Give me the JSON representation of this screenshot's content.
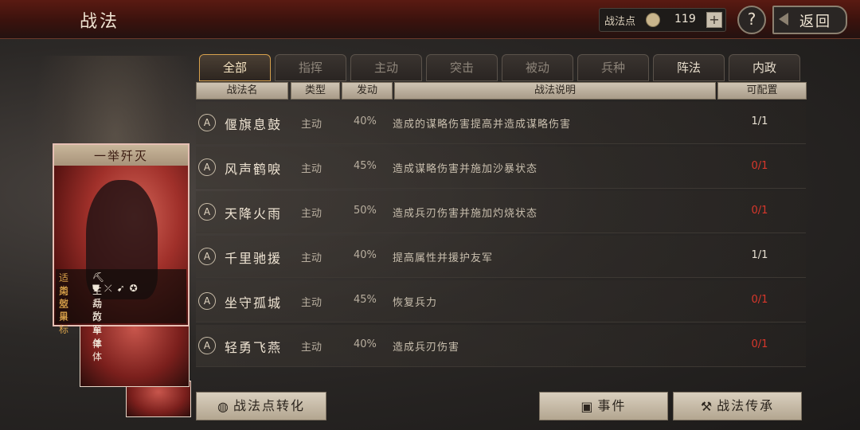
{
  "header": {
    "title": "战法",
    "points_label": "战法点",
    "points_value": "119",
    "plus_label": "+",
    "help_label": "?",
    "back_label": "返回"
  },
  "card": {
    "title": "一举歼灭",
    "info": [
      {
        "key": "适用",
        "value": ""
      },
      {
        "key": "类型",
        "value": "主动"
      },
      {
        "key": "效果",
        "value": "兵刃单体"
      },
      {
        "key": "目标",
        "value": "敌军单体"
      }
    ],
    "unit_icons": "⛏⛊⤫➹✪"
  },
  "tabs": [
    {
      "label": "全部",
      "state": "active"
    },
    {
      "label": "指挥",
      "state": "dim"
    },
    {
      "label": "主动",
      "state": "dim"
    },
    {
      "label": "突击",
      "state": "dim"
    },
    {
      "label": "被动",
      "state": "dim"
    },
    {
      "label": "兵种",
      "state": "dim"
    },
    {
      "label": "阵法",
      "state": "bright"
    },
    {
      "label": "内政",
      "state": "bright"
    }
  ],
  "columns": {
    "name": "战法名",
    "type": "类型",
    "rate": "发动",
    "desc": "战法说明",
    "config": "可配置"
  },
  "rows": [
    {
      "badge": "A",
      "name": "偃旗息鼓",
      "type": "主动",
      "rate": "40%",
      "desc": "造成的谋略伤害提高并造成谋略伤害",
      "config": "1/1",
      "config_color": "#e8e0d2"
    },
    {
      "badge": "A",
      "name": "风声鹤唳",
      "type": "主动",
      "rate": "45%",
      "desc": "造成谋略伤害并施加沙暴状态",
      "config": "0/1",
      "config_color": "#d9372b"
    },
    {
      "badge": "A",
      "name": "天降火雨",
      "type": "主动",
      "rate": "50%",
      "desc": "造成兵刃伤害并施加灼烧状态",
      "config": "0/1",
      "config_color": "#d9372b"
    },
    {
      "badge": "A",
      "name": "千里驰援",
      "type": "主动",
      "rate": "40%",
      "desc": "提高属性并援护友军",
      "config": "1/1",
      "config_color": "#e8e0d2"
    },
    {
      "badge": "A",
      "name": "坐守孤城",
      "type": "主动",
      "rate": "45%",
      "desc": "恢复兵力",
      "config": "0/1",
      "config_color": "#d9372b"
    },
    {
      "badge": "A",
      "name": "轻勇飞燕",
      "type": "主动",
      "rate": "40%",
      "desc": "造成兵刃伤害",
      "config": "0/1",
      "config_color": "#d9372b"
    }
  ],
  "buttons": {
    "convert": "战法点转化",
    "event": "事件",
    "inherit": "战法传承"
  }
}
